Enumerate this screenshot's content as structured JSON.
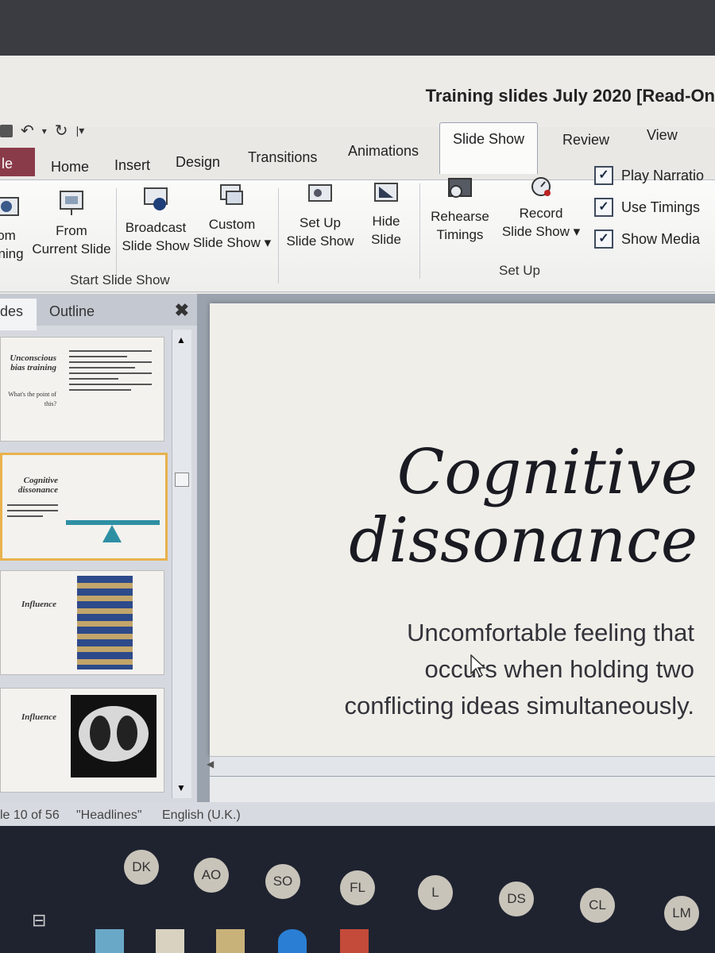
{
  "window": {
    "title": "Training slides July 2020 [Read-On"
  },
  "quick_access": {
    "undo_icon": "undo-icon",
    "redo_icon": "redo-icon",
    "save_icon": "save-icon"
  },
  "tabs": [
    {
      "label": "le"
    },
    {
      "label": "Home"
    },
    {
      "label": "Insert"
    },
    {
      "label": "Design"
    },
    {
      "label": "Transitions"
    },
    {
      "label": "Animations"
    },
    {
      "label": "Slide Show"
    },
    {
      "label": "Review"
    },
    {
      "label": "View"
    }
  ],
  "ribbon": {
    "from_beginning": {
      "line1": "om",
      "line2": "nning"
    },
    "from_current": {
      "line1": "From",
      "line2": "Current Slide"
    },
    "broadcast": {
      "line1": "Broadcast",
      "line2": "Slide Show"
    },
    "custom": {
      "line1": "Custom",
      "line2": "Slide Show ▾"
    },
    "start_group": "Start Slide Show",
    "setup_show": {
      "line1": "Set Up",
      "line2": "Slide Show"
    },
    "hide_slide": {
      "line1": "Hide",
      "line2": "Slide"
    },
    "rehearse": {
      "line1": "Rehearse",
      "line2": "Timings"
    },
    "record": {
      "line1": "Record",
      "line2": "Slide Show ▾"
    },
    "setup_group": "Set Up",
    "checks": [
      {
        "label": "Play Narratio",
        "checked": true
      },
      {
        "label": "Use Timings",
        "checked": true
      },
      {
        "label": "Show Media",
        "checked": true
      }
    ]
  },
  "panel": {
    "tab_slides": "des",
    "tab_outline": "Outline",
    "close": "✖",
    "thumbs": [
      {
        "title": "Unconscious bias training",
        "sub": "What's the point of this?"
      },
      {
        "title": "Cognitive dissonance",
        "sub": ""
      },
      {
        "title": "Influence",
        "sub": ""
      },
      {
        "title": "Influence",
        "sub": ""
      }
    ]
  },
  "slide": {
    "title_line1": "Cognitive",
    "title_line2": "dissonance",
    "subtitle": "Uncomfortable feeling that occurs when holding two conflicting ideas simultaneously."
  },
  "status": {
    "slide_pos": "le 10 of 56",
    "theme": "\"Headlines\"",
    "language": "English (U.K.)"
  },
  "taskbar": {
    "avatars": [
      "DK",
      "AO",
      "SO",
      "FL",
      "L",
      "DS",
      "CL",
      "LM"
    ]
  },
  "colors": {
    "file_tab": "#8a3b4a",
    "selection": "#e8b24c",
    "check_blue": "#3e4b5e"
  }
}
